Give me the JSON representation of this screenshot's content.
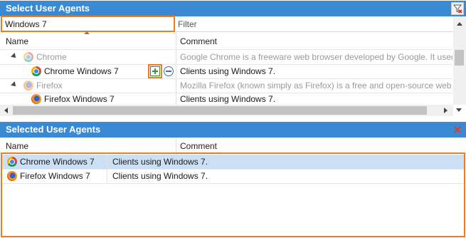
{
  "top_panel": {
    "title": "Select User Agents",
    "search": {
      "value": "Windows 7",
      "placeholder": ""
    },
    "filter": {
      "placeholder": "Filter"
    },
    "columns": {
      "name": "Name",
      "comment": "Comment"
    },
    "rows": [
      {
        "name": "Chrome",
        "comment": "Google Chrome is a freeware web browser developed by Google. It used the WebKit",
        "kind": "group",
        "browser": "chrome"
      },
      {
        "name": "Chrome Windows 7",
        "comment": "Clients using Windows 7.",
        "kind": "item",
        "browser": "chrome"
      },
      {
        "name": "Firefox",
        "comment": "Mozilla Firefox (known simply as Firefox) is a free and open-source web browser dev",
        "kind": "group",
        "browser": "firefox"
      },
      {
        "name": "Firefox Windows 7",
        "comment": "Clients using Windows 7.",
        "kind": "item",
        "browser": "firefox"
      }
    ],
    "add_icon": "plus-icon",
    "remove_icon": "minus-icon"
  },
  "bottom_panel": {
    "title": "Selected User Agents",
    "columns": {
      "name": "Name",
      "comment": "Comment"
    },
    "rows": [
      {
        "name": "Chrome Windows 7",
        "comment": "Clients using Windows 7.",
        "browser": "chrome",
        "selected": true
      },
      {
        "name": "Firefox Windows 7",
        "comment": "Clients using Windows 7.",
        "browser": "firefox",
        "selected": false
      }
    ]
  },
  "colors": {
    "header": "#3a8ad3",
    "highlight": "#ef7c21",
    "selected_row": "#cce0f5"
  }
}
